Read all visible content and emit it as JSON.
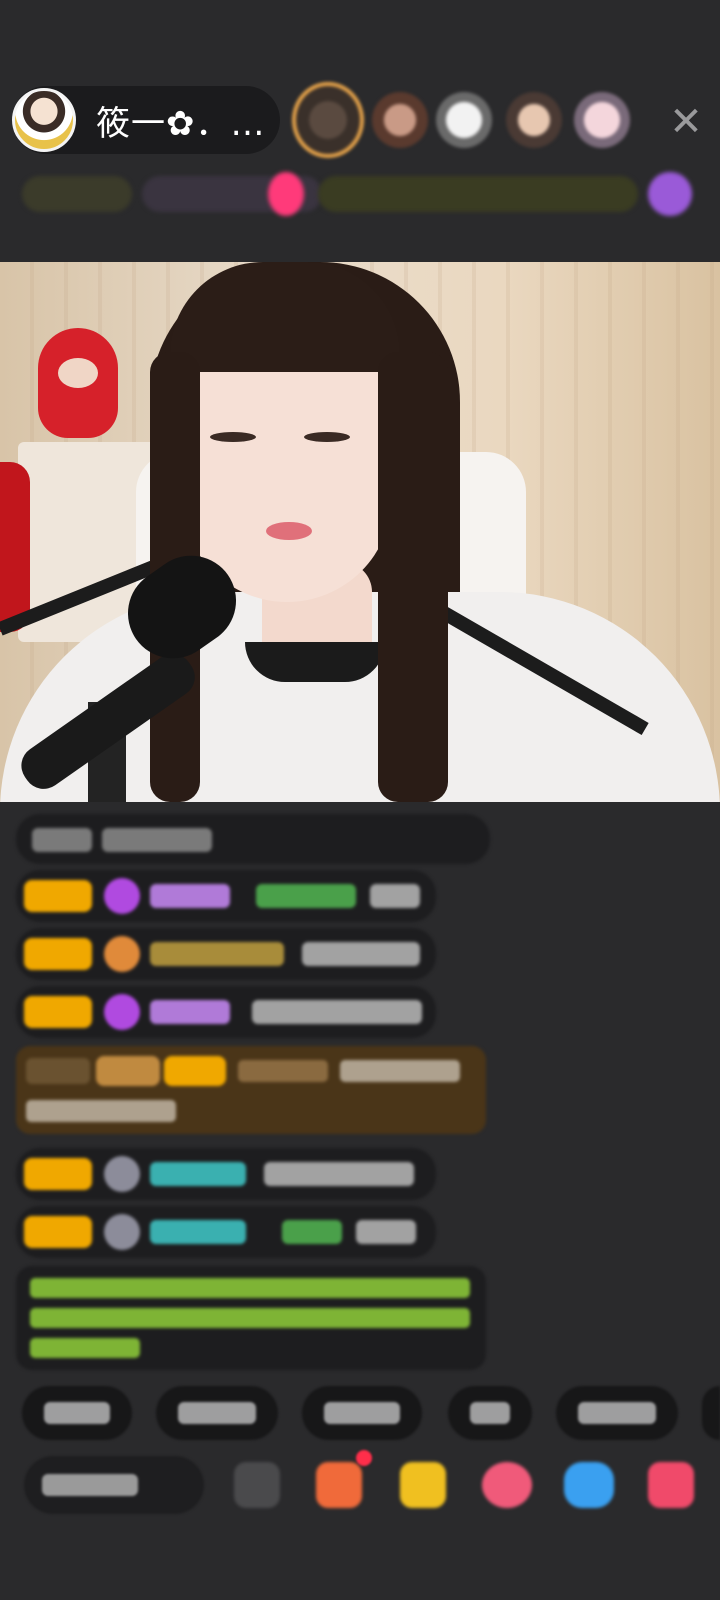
{
  "host": {
    "name": "筱一✿．…"
  },
  "top_controls": {
    "close_icon": "close-icon"
  },
  "colors": {
    "background": "#2a2a2c",
    "vip_badge": "#f0a800",
    "chat_bubble": "#1d1d1f",
    "highlight_message": "#4a3518",
    "system_message_text": "#8fcf3a"
  },
  "chat": {
    "system_message_visible": true,
    "message_count": 7
  },
  "toolbar": {
    "icons": [
      "keyboard-icon",
      "gift-box-icon",
      "treasure-chest-icon",
      "heart-icon",
      "game-controller-icon",
      "gift-icon"
    ]
  }
}
